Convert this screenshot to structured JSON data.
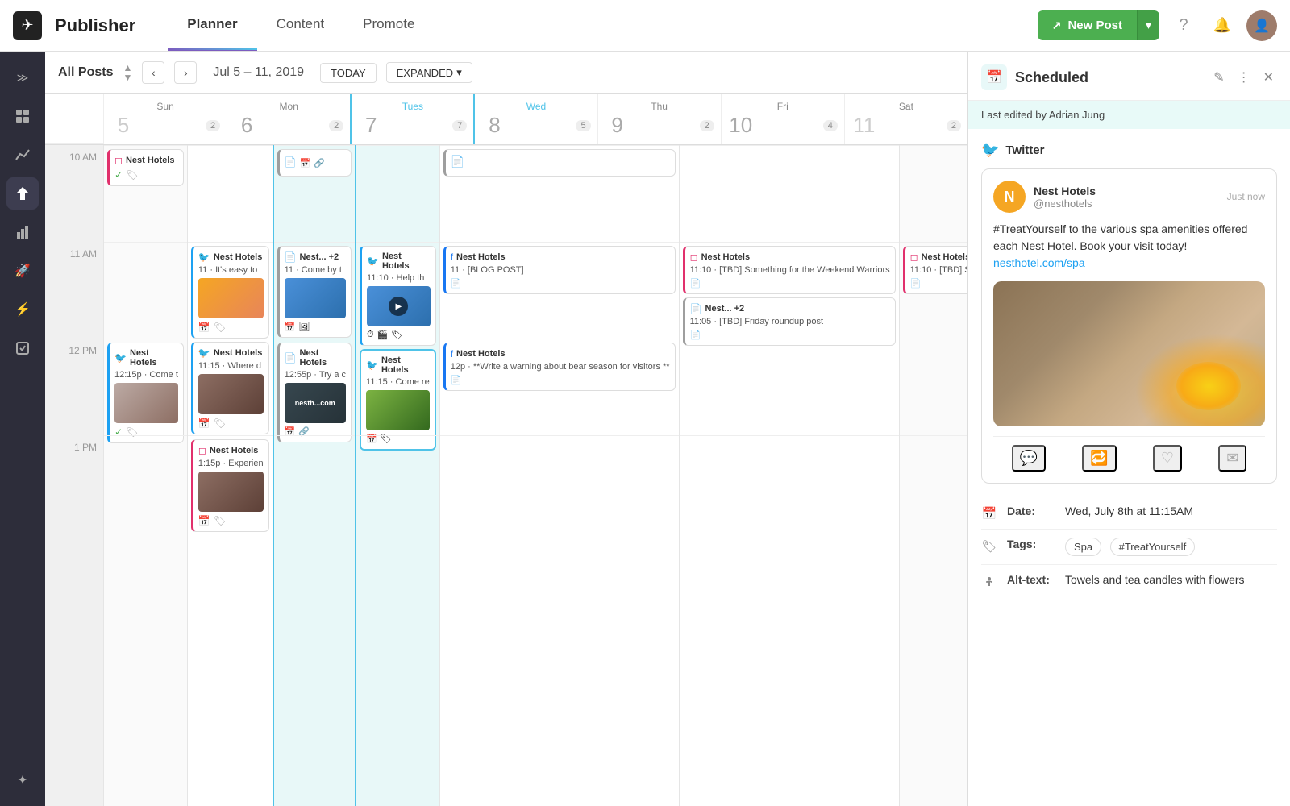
{
  "app": {
    "logo_char": "✈",
    "brand": "Publisher"
  },
  "nav": {
    "tabs": [
      {
        "id": "planner",
        "label": "Planner",
        "active": true
      },
      {
        "id": "content",
        "label": "Content",
        "active": false
      },
      {
        "id": "promote",
        "label": "Promote",
        "active": false
      }
    ],
    "new_post_label": "New Post",
    "new_post_icon": "↗"
  },
  "sidebar": {
    "items": [
      {
        "id": "expand",
        "icon": "≫",
        "label": "expand-sidebar"
      },
      {
        "id": "dashboard",
        "icon": "⊞",
        "label": "dashboard-icon"
      },
      {
        "id": "analytics",
        "icon": "↑",
        "label": "analytics-icon"
      },
      {
        "id": "publish",
        "icon": "✈",
        "label": "publish-icon",
        "active": true
      },
      {
        "id": "reports",
        "icon": "▦",
        "label": "reports-icon"
      },
      {
        "id": "boost",
        "icon": "🚀",
        "label": "boost-icon"
      },
      {
        "id": "lightning",
        "icon": "⚡",
        "label": "lightning-icon"
      },
      {
        "id": "tasks",
        "icon": "✓",
        "label": "tasks-icon"
      },
      {
        "id": "apps",
        "icon": "✦",
        "label": "apps-icon"
      }
    ]
  },
  "calendar": {
    "all_posts_label": "All Posts",
    "date_range": "Jul 5 – 11, 2019",
    "today_label": "TODAY",
    "expanded_label": "EXPANDED",
    "days": [
      {
        "name": "Sun",
        "num": "5",
        "count": 2
      },
      {
        "name": "Mon",
        "num": "6",
        "count": 2
      },
      {
        "name": "Tues",
        "num": "7",
        "count": 7
      },
      {
        "name": "Wed",
        "num": "8",
        "count": 5
      },
      {
        "name": "Thu",
        "num": "9",
        "count": 2
      },
      {
        "name": "Fri",
        "num": "10",
        "count": 4
      },
      {
        "name": "Sat",
        "num": "11",
        "count": 2
      }
    ],
    "time_slots": [
      "10 AM",
      "11 AM",
      "12 PM",
      "1 PM"
    ],
    "posts": [
      {
        "id": "p1",
        "day": 0,
        "slot": 0,
        "platform": "instagram",
        "account": "Nest Hotels",
        "time": "",
        "text": "",
        "has_img": false,
        "icons": [
          "calendar",
          "tag"
        ],
        "check": true
      },
      {
        "id": "p2",
        "day": 1,
        "slot": 1,
        "platform": "twitter",
        "account": "Nest Hotels",
        "time": "11",
        "text": "It's easy to",
        "img_class": "img-drinks",
        "has_img": true,
        "icons": [
          "calendar",
          "tag"
        ]
      },
      {
        "id": "p3",
        "day": 2,
        "slot": 1,
        "platform": "cms",
        "account": "Nest...",
        "time": "11",
        "text": "Come by t",
        "img_class": "img-cocktail",
        "has_img": true,
        "extra": "+2",
        "icons": [
          "calendar",
          "image"
        ]
      },
      {
        "id": "p4",
        "day": 3,
        "slot": 1,
        "platform": "twitter",
        "account": "Nest Hotels",
        "time": "11:10",
        "text": "Help th",
        "img_class": "img-cocktail",
        "has_img": true,
        "is_video": true,
        "icons": [
          "clock",
          "video",
          "tag"
        ],
        "is_today": true
      },
      {
        "id": "p5",
        "day": 5,
        "slot": 1,
        "platform": "facebook",
        "account": "Nest Hotels",
        "time": "11",
        "text": "[BLOG POST]",
        "has_img": false,
        "icons": [
          "document"
        ]
      },
      {
        "id": "p6",
        "day": 6,
        "slot": 1,
        "platform": "instagram",
        "account": "Nest Hotels",
        "time": "11:10",
        "text": "[TBD] Something for the Weekend Warriors",
        "has_img": false,
        "icons": [
          "document"
        ]
      },
      {
        "id": "p7",
        "day": 1,
        "slot": 2,
        "platform": "twitter",
        "account": "Nest Hotels",
        "time": "11:15",
        "text": "Where d",
        "img_class": "img-room",
        "has_img": true,
        "icons": [
          "calendar",
          "tag"
        ]
      },
      {
        "id": "p8",
        "day": 3,
        "slot": 2,
        "platform": "twitter",
        "account": "Nest Hotels",
        "time": "11:15",
        "text": "Come re",
        "img_class": "img-mojito",
        "has_img": true,
        "icons": [
          "calendar",
          "tag"
        ],
        "is_today": true,
        "selected": true
      },
      {
        "id": "p9",
        "day": 5,
        "slot": 2,
        "platform": "cms",
        "account": "Nest...",
        "time": "11:05",
        "text": "[TBD] Friday roundup post",
        "has_img": false,
        "extra": "+2",
        "icons": [
          "document"
        ]
      },
      {
        "id": "p10",
        "day": 1,
        "slot": 3,
        "platform": "twitter",
        "account": "Nest Hotels",
        "time": "12:15p",
        "text": "Come t",
        "img_class": "img-towel",
        "has_img": true,
        "icons": [
          "calendar",
          "tag"
        ],
        "check": true
      },
      {
        "id": "p11",
        "day": 2,
        "slot": 3,
        "platform": "cms",
        "account": "Nest Hotels",
        "time": "12:55p",
        "text": "Try a c",
        "img_class": "img-nesth",
        "has_img": true,
        "img_text": "nesth...com",
        "icons": [
          "calendar",
          "link"
        ],
        "is_today": true
      },
      {
        "id": "p12",
        "day": 4,
        "slot": 3,
        "platform": "facebook",
        "account": "Nest Hotels",
        "time": "12p",
        "text": "**Write a warning about bear season for visitors **",
        "has_img": false,
        "icons": [
          "document"
        ]
      },
      {
        "id": "p13",
        "day": 1,
        "slot": 4,
        "platform": "instagram",
        "account": "Nest Hotels",
        "time": "1:15p",
        "text": "Experien",
        "img_class": "img-room",
        "has_img": true,
        "icons": [
          "calendar",
          "tag"
        ]
      }
    ]
  },
  "panel": {
    "status": "Scheduled",
    "calendar_icon": "📅",
    "last_edited": "Last edited by Adrian Jung",
    "platform": "Twitter",
    "author": {
      "name": "Nest Hotels",
      "handle": "@nesthotels",
      "time": "Just now",
      "avatar_text": "N",
      "avatar_bg": "#f5a623"
    },
    "tweet_text": "#TreatYourself to the various spa amenities offered each Nest Hotel. Book your visit today! nesthotel.com/spa",
    "tweet_link": "nesthotel.com/spa",
    "date_label": "Date:",
    "date_value": "Wed, July 8th at 11:15AM",
    "tags_label": "Tags:",
    "tags": [
      "Spa",
      "#TreatYourself"
    ],
    "alt_text_label": "Alt-text:",
    "alt_text_value": "Towels and tea candles with flowers",
    "actions": {
      "edit": "✎",
      "more": "⋮",
      "close": "✕"
    }
  }
}
